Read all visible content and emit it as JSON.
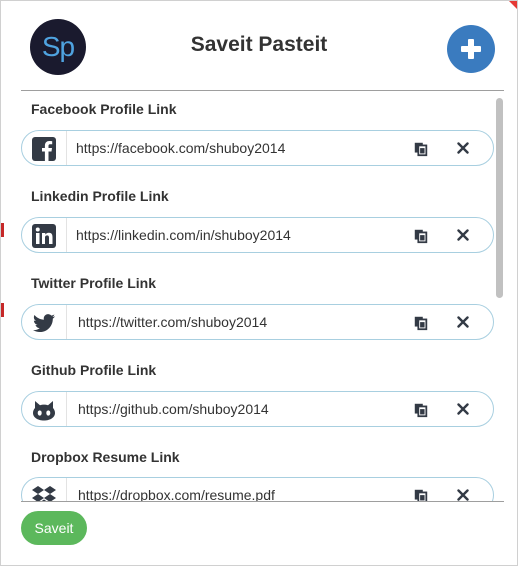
{
  "app": {
    "logo_text": "Sp",
    "title": "Saveit Pasteit"
  },
  "fields": [
    {
      "label": "Facebook Profile Link",
      "value": "https://facebook.com/shuboy2014",
      "icon": "facebook-icon"
    },
    {
      "label": "Linkedin Profile Link",
      "value": "https://linkedin.com/in/shuboy2014",
      "icon": "linkedin-icon"
    },
    {
      "label": "Twitter Profile Link",
      "value": "https://twitter.com/shuboy2014",
      "icon": "twitter-icon"
    },
    {
      "label": "Github Profile Link",
      "value": "https://github.com/shuboy2014",
      "icon": "github-icon"
    },
    {
      "label": "Dropbox Resume Link",
      "value": "https://dropbox.com/resume.pdf",
      "icon": "dropbox-icon"
    }
  ],
  "footer": {
    "save_label": "Saveit"
  },
  "colors": {
    "accent_blue": "#3a7bbf",
    "save_green": "#5cb85c",
    "field_border": "#a8cfe0",
    "icon_dark": "#333a45"
  }
}
